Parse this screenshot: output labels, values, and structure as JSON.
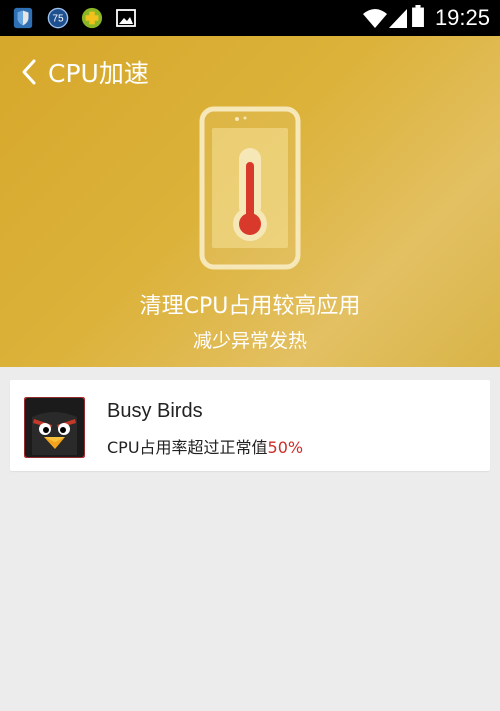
{
  "status_bar": {
    "time": "19:25",
    "notification_badge": "75",
    "icons": [
      "shield-icon",
      "badge-75-icon",
      "cross-app-icon",
      "image-icon",
      "wifi-icon",
      "signal-icon",
      "battery-icon"
    ]
  },
  "header": {
    "title": "CPU加速",
    "main_text": "清理CPU占用较高应用",
    "sub_text": "减少异常发热",
    "background_color": "#d8ad35"
  },
  "apps": [
    {
      "name": "Busy Birds",
      "desc_prefix": "CPU占用率超过正常值",
      "percent": "50%",
      "icon": "angry-bird-icon"
    }
  ],
  "colors": {
    "accent_percent": "#cc2e2a",
    "page_bg": "#ececec"
  }
}
